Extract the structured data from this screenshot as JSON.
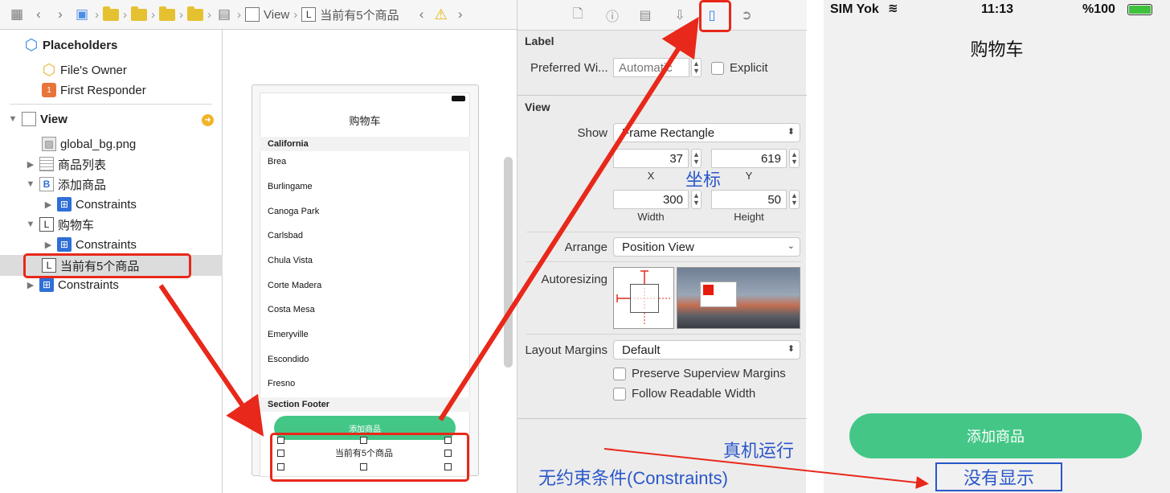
{
  "breadcrumb": {
    "items": [
      "View",
      "当前有5个商品"
    ],
    "item_icons": [
      "view-box-icon",
      "label-icon"
    ],
    "label_glyph": "L"
  },
  "outline": {
    "placeholders_title": "Placeholders",
    "files_owner": "File's Owner",
    "first_responder": "First Responder",
    "view_label": "View",
    "items": [
      {
        "label": "global_bg.png",
        "icon": "image-icon"
      },
      {
        "label": "商品列表",
        "icon": "table-icon"
      },
      {
        "label": "添加商品",
        "icon": "button-icon",
        "glyph": "B"
      },
      {
        "label": "Constraints",
        "icon": "constraints-icon"
      },
      {
        "label": "购物车",
        "icon": "label-icon",
        "glyph": "L"
      },
      {
        "label": "Constraints",
        "icon": "constraints-icon"
      },
      {
        "label": "当前有5个商品",
        "icon": "label-icon",
        "glyph": "L",
        "selected": true
      },
      {
        "label": "Constraints",
        "icon": "constraints-icon"
      }
    ]
  },
  "canvas": {
    "nav_title": "购物车",
    "section_header": "California",
    "cities": [
      "Brea",
      "Burlingame",
      "Canoga Park",
      "Carlsbad",
      "Chula Vista",
      "Corte Madera",
      "Costa Mesa",
      "Emeryville",
      "Escondido",
      "Fresno"
    ],
    "section_footer": "Section Footer",
    "add_button": "添加商品",
    "count_label": "当前有5个商品"
  },
  "inspector": {
    "label_section": "Label",
    "preferred_width_label": "Preferred Wi...",
    "preferred_width_placeholder": "Automatic",
    "explicit_label": "Explicit",
    "view_section": "View",
    "show_label": "Show",
    "show_value": "Frame Rectangle",
    "x_value": "37",
    "y_value": "619",
    "x_caption": "X",
    "y_caption": "Y",
    "width_value": "300",
    "height_value": "50",
    "width_caption": "Width",
    "height_caption": "Height",
    "arrange_label": "Arrange",
    "arrange_value": "Position View",
    "autoresizing_label": "Autoresizing",
    "layout_margins_label": "Layout Margins",
    "layout_margins_value": "Default",
    "preserve_margins_label": "Preserve Superview Margins",
    "follow_readable_label": "Follow Readable Width"
  },
  "phone": {
    "carrier": "SIM Yok",
    "time": "11:13",
    "battery": "%100",
    "title": "购物车",
    "add_button": "添加商品"
  },
  "annotations": {
    "coordinates_note": "坐标",
    "device_run_note": "真机运行",
    "no_constraints_note": "无约束条件(Constraints)",
    "not_shown_note": "没有显示"
  },
  "colors": {
    "annotation_red": "#e8281a",
    "annotation_blue": "#2a57c9",
    "button_green": "#44c786",
    "inspector_active": "#2d7ff0"
  }
}
